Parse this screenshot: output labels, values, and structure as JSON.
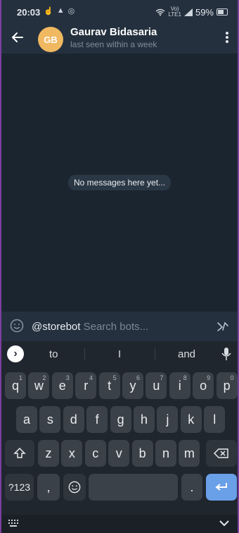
{
  "status": {
    "time": "20:03",
    "battery": "59%",
    "net_top": "Vo)",
    "net_bottom": "LTE1"
  },
  "header": {
    "avatar_initials": "GB",
    "name": "Gaurav Bidasaria",
    "status": "last seen within a week"
  },
  "chat": {
    "empty_text": "No messages here yet..."
  },
  "input": {
    "mention": "@storebot",
    "placeholder": "Search bots..."
  },
  "suggestions": [
    "to",
    "I",
    "and"
  ],
  "keyboard": {
    "row1": [
      [
        "q",
        "1"
      ],
      [
        "w",
        "2"
      ],
      [
        "e",
        "3"
      ],
      [
        "r",
        "4"
      ],
      [
        "t",
        "5"
      ],
      [
        "y",
        "6"
      ],
      [
        "u",
        "7"
      ],
      [
        "i",
        "8"
      ],
      [
        "o",
        "9"
      ],
      [
        "p",
        "0"
      ]
    ],
    "row2": [
      "a",
      "s",
      "d",
      "f",
      "g",
      "h",
      "j",
      "k",
      "l"
    ],
    "row3": [
      "z",
      "x",
      "c",
      "v",
      "b",
      "n",
      "m"
    ],
    "symbols_label": "?123",
    "comma": ",",
    "period": "."
  },
  "colors": {
    "avatar": "#f0b860",
    "accent": "#6aa0e8",
    "background": "#1b2530"
  }
}
